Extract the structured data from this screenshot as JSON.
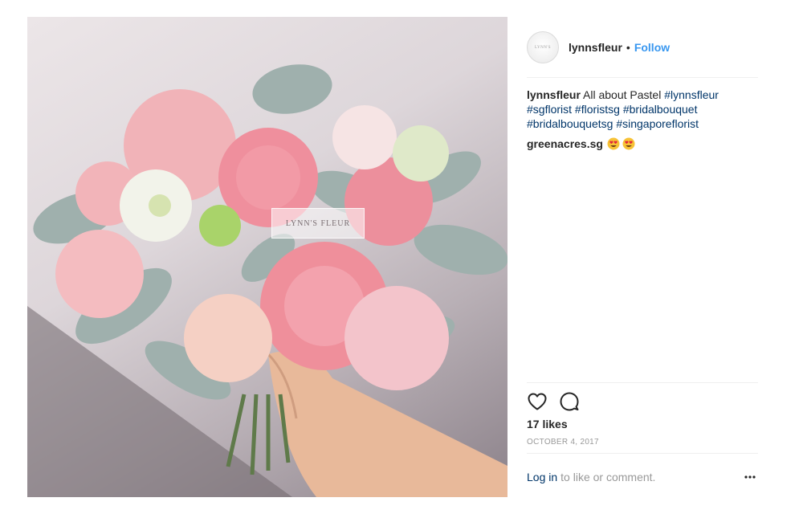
{
  "photo": {
    "watermark": "LYNN'S FLEUR"
  },
  "post": {
    "username": "lynnsfleur",
    "separator": "•",
    "follow_label": "Follow",
    "caption": {
      "text": "All about Pastel",
      "hashtags": [
        "#lynnsfleur",
        "#sgflorist",
        "#floristsg",
        "#bridalbouquet",
        "#bridalbouquetsg",
        "#singaporeflorist"
      ]
    },
    "comment": {
      "username": "greenacres.sg",
      "emojis": [
        "heart-eyes-emoji",
        "heart-eyes-emoji"
      ]
    },
    "actions": {
      "like_icon": "heart-icon",
      "comment_icon": "comment-icon"
    },
    "likes": "17 likes",
    "date": "OCTOBER 4, 2017",
    "login": {
      "link": "Log in",
      "rest": "to like or comment."
    },
    "more_icon": "ellipsis-icon"
  },
  "colors": {
    "link_blue": "#3897f0",
    "hashtag": "#003569",
    "muted": "#999999",
    "text": "#262626",
    "divider": "#efefef"
  }
}
